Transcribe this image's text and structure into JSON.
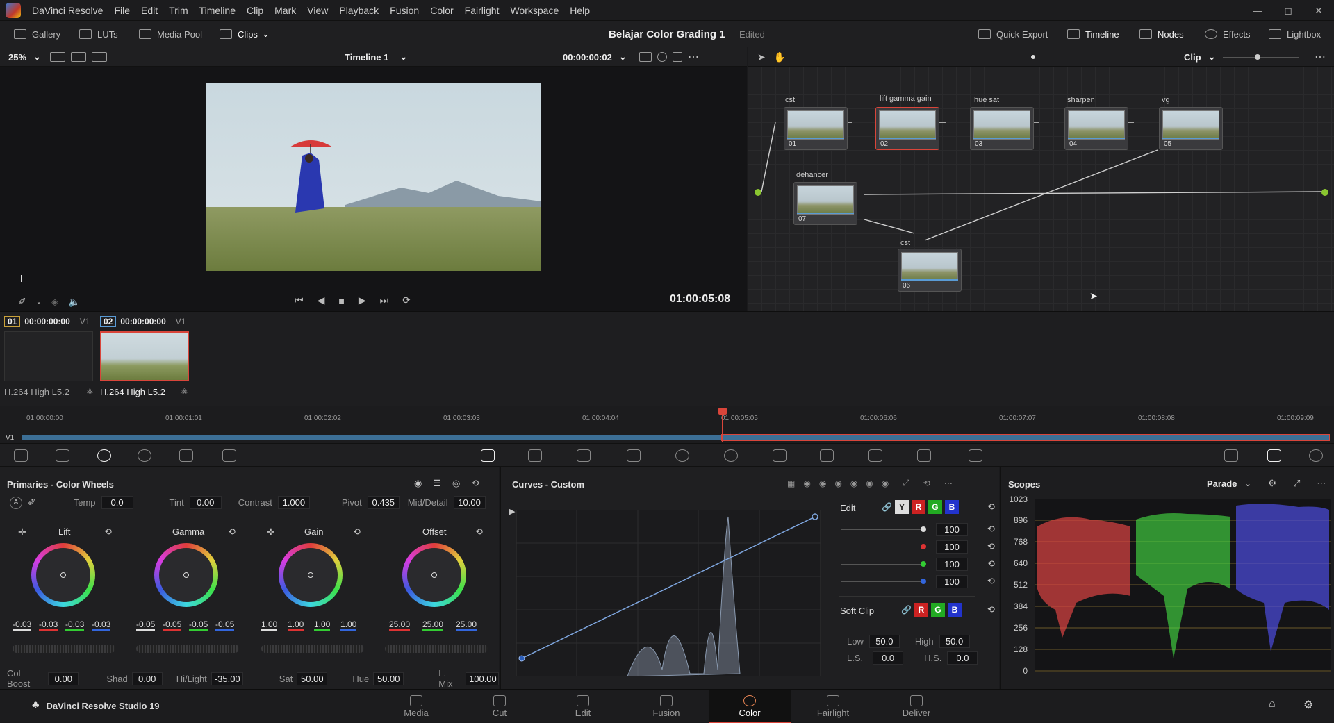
{
  "app": {
    "name": "DaVinci Resolve",
    "menus": [
      "File",
      "Edit",
      "Trim",
      "Timeline",
      "Clip",
      "Mark",
      "View",
      "Playback",
      "Fusion",
      "Color",
      "Fairlight",
      "Workspace",
      "Help"
    ]
  },
  "toolbar": {
    "left": [
      "Gallery",
      "LUTs",
      "Media Pool",
      "Clips"
    ],
    "project": "Belajar Color Grading 1",
    "status": "Edited",
    "right": [
      "Quick Export",
      "Timeline",
      "Nodes",
      "Effects",
      "Lightbox"
    ]
  },
  "viewer": {
    "zoom": "25%",
    "timeline": "Timeline 1",
    "timecode": "00:00:00:02",
    "position": "01:00:05:08"
  },
  "nodes": {
    "mode": "Clip",
    "list": [
      {
        "label": "cst",
        "num": "01"
      },
      {
        "label": "lift gamma gain",
        "num": "02"
      },
      {
        "label": "hue sat",
        "num": "03"
      },
      {
        "label": "sharpen",
        "num": "04"
      },
      {
        "label": "vg",
        "num": "05"
      },
      {
        "label": "dehancer",
        "num": "07"
      },
      {
        "label": "cst",
        "num": "06"
      }
    ]
  },
  "clips": [
    {
      "index": "01",
      "tc": "00:00:00:00",
      "track": "V1",
      "codec": "H.264 High L5.2"
    },
    {
      "index": "02",
      "tc": "00:00:00:00",
      "track": "V1",
      "codec": "H.264 High L5.2"
    }
  ],
  "ruler": {
    "track": "V1",
    "ticks": [
      "01:00:00:00",
      "01:00:01:01",
      "01:00:02:02",
      "01:00:03:03",
      "01:00:04:04",
      "01:00:05:05",
      "01:00:06:06",
      "01:00:07:07",
      "01:00:08:08",
      "01:00:09:09"
    ]
  },
  "primaries": {
    "title": "Primaries - Color Wheels",
    "temp_l": "Temp",
    "temp": "0.0",
    "tint_l": "Tint",
    "tint": "0.00",
    "contrast_l": "Contrast",
    "contrast": "1.000",
    "pivot_l": "Pivot",
    "pivot": "0.435",
    "md_l": "Mid/Detail",
    "md": "10.00",
    "wheels": [
      {
        "name": "Lift",
        "vals": [
          "-0.03",
          "-0.03",
          "-0.03",
          "-0.03"
        ]
      },
      {
        "name": "Gamma",
        "vals": [
          "-0.05",
          "-0.05",
          "-0.05",
          "-0.05"
        ]
      },
      {
        "name": "Gain",
        "vals": [
          "1.00",
          "1.00",
          "1.00",
          "1.00"
        ]
      },
      {
        "name": "Offset",
        "vals": [
          "25.00",
          "25.00",
          "25.00"
        ]
      }
    ],
    "cb_l": "Col Boost",
    "cb": "0.00",
    "shad_l": "Shad",
    "shad": "0.00",
    "hl_l": "Hi/Light",
    "hl": "-35.00",
    "sat_l": "Sat",
    "sat": "50.00",
    "hue_l": "Hue",
    "hue": "50.00",
    "lmix_l": "L. Mix",
    "lmix": "100.00"
  },
  "curves": {
    "title": "Curves - Custom",
    "edit": "Edit",
    "ch": [
      "Y",
      "R",
      "G",
      "B"
    ],
    "vals": [
      "100",
      "100",
      "100",
      "100"
    ],
    "softclip": "Soft Clip",
    "low_l": "Low",
    "low": "50.0",
    "high_l": "High",
    "high": "50.0",
    "ls_l": "L.S.",
    "ls": "0.0",
    "hs_l": "H.S.",
    "hs": "0.0"
  },
  "scopes": {
    "title": "Scopes",
    "mode": "Parade",
    "ticks": [
      "1023",
      "896",
      "768",
      "640",
      "512",
      "384",
      "256",
      "128",
      "0"
    ]
  },
  "bottom": {
    "brand": "DaVinci Resolve Studio 19",
    "pages": [
      "Media",
      "Cut",
      "Edit",
      "Fusion",
      "Color",
      "Fairlight",
      "Deliver"
    ],
    "active": "Color"
  },
  "colors": {
    "accent": "#d9453a",
    "blue": "#5a9bd5"
  }
}
